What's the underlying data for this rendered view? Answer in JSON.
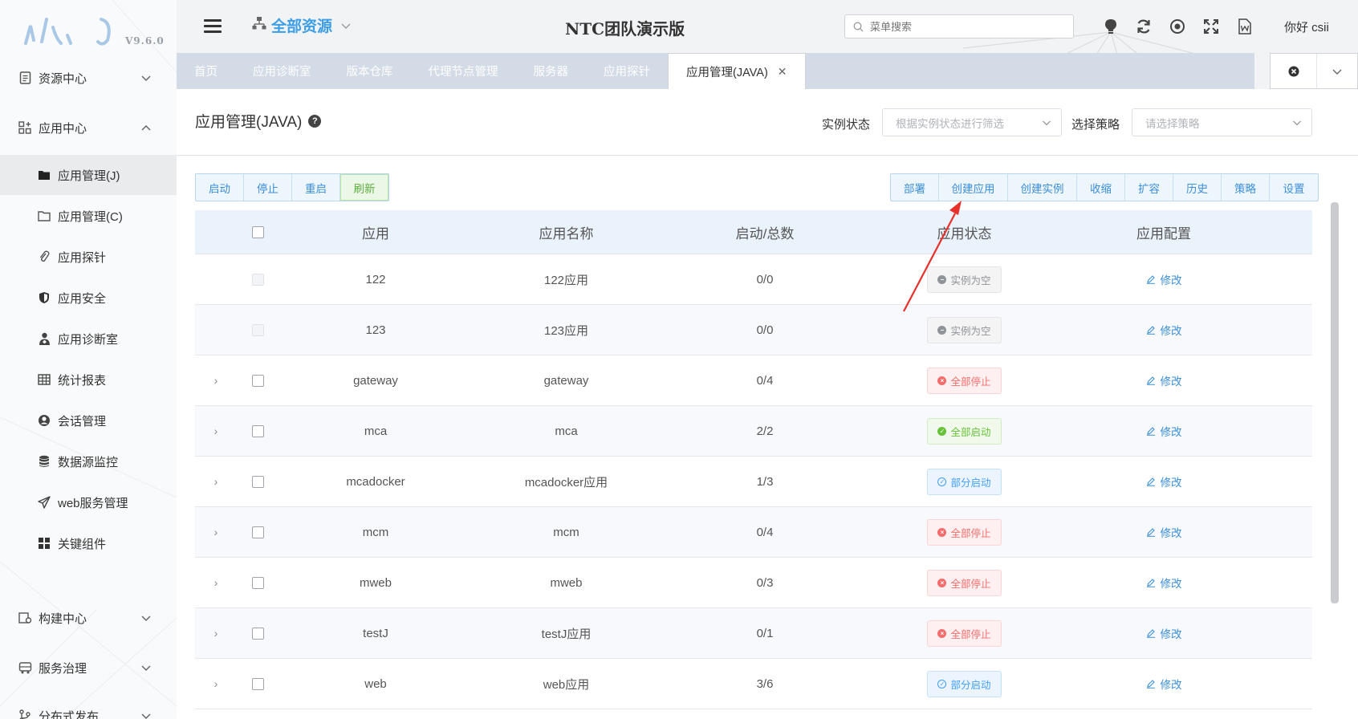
{
  "app": {
    "logo_version": "V9.6.0",
    "resource_selector": "全部资源",
    "center_title": "NTC团队演示版",
    "search_placeholder": "菜单搜索",
    "greeting": "你好 csii"
  },
  "sidebar": {
    "groups": [
      {
        "label": "资源中心",
        "icon": "document-icon",
        "expanded": false
      },
      {
        "label": "应用中心",
        "icon": "apps-add-icon",
        "expanded": true
      },
      {
        "label": "构建中心",
        "icon": "build-icon",
        "expanded": false
      },
      {
        "label": "服务治理",
        "icon": "bus-icon",
        "expanded": false
      },
      {
        "label": "分布式发布",
        "icon": "branch-icon",
        "expanded": false
      }
    ],
    "sub_items": [
      {
        "label": "应用管理(J)",
        "icon": "folder-filled-icon",
        "active": true
      },
      {
        "label": "应用管理(C)",
        "icon": "folder-outline-icon",
        "active": false
      },
      {
        "label": "应用探针",
        "icon": "paperclip-icon",
        "active": false
      },
      {
        "label": "应用安全",
        "icon": "shield-icon",
        "active": false
      },
      {
        "label": "应用诊断室",
        "icon": "doctor-icon",
        "active": false
      },
      {
        "label": "统计报表",
        "icon": "table-icon",
        "active": false
      },
      {
        "label": "会话管理",
        "icon": "user-circle-icon",
        "active": false
      },
      {
        "label": "数据源监控",
        "icon": "database-icon",
        "active": false
      },
      {
        "label": "web服务管理",
        "icon": "paper-plane-icon",
        "active": false
      },
      {
        "label": "关键组件",
        "icon": "grid-icon",
        "active": false
      }
    ]
  },
  "tabs": [
    {
      "label": "首页",
      "active": false
    },
    {
      "label": "应用诊断室",
      "active": false
    },
    {
      "label": "版本仓库",
      "active": false
    },
    {
      "label": "代理节点管理",
      "active": false
    },
    {
      "label": "服务器",
      "active": false
    },
    {
      "label": "应用探针",
      "active": false
    },
    {
      "label": "应用管理(JAVA)",
      "active": true
    }
  ],
  "page": {
    "title": "应用管理(JAVA)",
    "filters": {
      "status_label": "实例状态",
      "status_placeholder": "根据实例状态进行筛选",
      "strategy_label": "选择策略",
      "strategy_placeholder": "请选择策略"
    },
    "left_buttons": [
      "启动",
      "停止",
      "重启",
      "刷新"
    ],
    "right_buttons": [
      "部署",
      "创建应用",
      "创建实例",
      "收缩",
      "扩容",
      "历史",
      "策略",
      "设置"
    ]
  },
  "table": {
    "columns": [
      "应用",
      "应用名称",
      "启动/总数",
      "应用状态",
      "应用配置"
    ],
    "rows": [
      {
        "app": "122",
        "name": "122应用",
        "count": "0/0",
        "status": "实例为空",
        "status_type": "empty",
        "action": "修改",
        "expandable": false
      },
      {
        "app": "123",
        "name": "123应用",
        "count": "0/0",
        "status": "实例为空",
        "status_type": "empty",
        "action": "修改",
        "expandable": false
      },
      {
        "app": "gateway",
        "name": "gateway",
        "count": "0/4",
        "status": "全部停止",
        "status_type": "stop",
        "action": "修改",
        "expandable": true
      },
      {
        "app": "mca",
        "name": "mca",
        "count": "2/2",
        "status": "全部启动",
        "status_type": "start",
        "action": "修改",
        "expandable": true
      },
      {
        "app": "mcadocker",
        "name": "mcadocker应用",
        "count": "1/3",
        "status": "部分启动",
        "status_type": "part",
        "action": "修改",
        "expandable": true
      },
      {
        "app": "mcm",
        "name": "mcm",
        "count": "0/4",
        "status": "全部停止",
        "status_type": "stop",
        "action": "修改",
        "expandable": true
      },
      {
        "app": "mweb",
        "name": "mweb",
        "count": "0/3",
        "status": "全部停止",
        "status_type": "stop",
        "action": "修改",
        "expandable": true
      },
      {
        "app": "testJ",
        "name": "testJ应用",
        "count": "0/1",
        "status": "全部停止",
        "status_type": "stop",
        "action": "修改",
        "expandable": true
      },
      {
        "app": "web",
        "name": "web应用",
        "count": "3/6",
        "status": "部分启动",
        "status_type": "part",
        "action": "修改",
        "expandable": true
      }
    ]
  },
  "colors": {
    "accent": "#3c9ee6",
    "stop": "#f56c6c",
    "start": "#67c23a",
    "part": "#409eff",
    "empty": "#909399",
    "annotation_arrow": "#e8302a"
  }
}
